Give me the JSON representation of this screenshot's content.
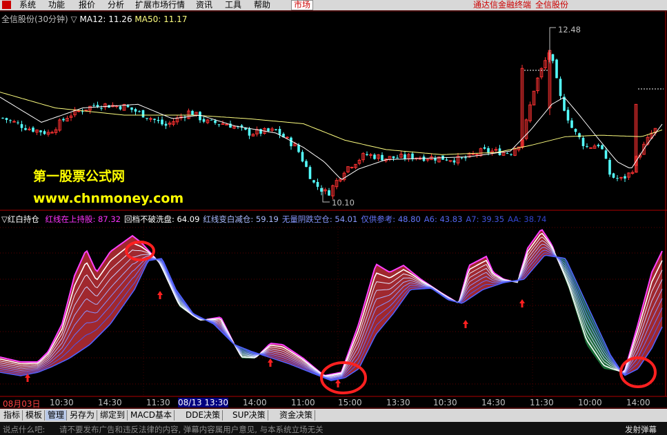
{
  "menu": {
    "items": [
      "系统",
      "功能",
      "报价",
      "分析",
      "扩展市场行情",
      "资讯",
      "工具",
      "帮助"
    ],
    "active": "市场",
    "right_items": [
      "通达信金融终端",
      "全信股份"
    ]
  },
  "main_chart": {
    "title": "全信股份(30分钟)",
    "ma12_label": "MA12: 11.26",
    "ma50_label": "MA50: 11.17",
    "high_label": "12.48",
    "low_label": "10.10"
  },
  "watermark": {
    "line1": "第一股票公式网",
    "line2": "www.chnmoney.com"
  },
  "indicator": {
    "title": "▽红白持仓",
    "items": [
      {
        "label": "红线在上持股:",
        "value": "87.32",
        "color": "#ff33ff"
      },
      {
        "label": "回档不破洗盘:",
        "value": "64.09",
        "color": "#ffffff"
      },
      {
        "label": "红线变白减仓:",
        "value": "59.19",
        "color": "#aabbff"
      },
      {
        "label": "无量阴跌空仓:",
        "value": "54.01",
        "color": "#8899ff"
      },
      {
        "label": "仅供参考:",
        "value": "48.80",
        "color": "#6677ff"
      },
      {
        "label": "A6:",
        "value": "43.83",
        "color": "#5566ee"
      },
      {
        "label": "A7:",
        "value": "39.35",
        "color": "#4455dd"
      },
      {
        "label": "AA:",
        "value": "38.74",
        "color": "#3344cc"
      }
    ]
  },
  "time_axis": [
    "08月03日",
    "10:30",
    "14:30",
    "11:30",
    "08/13 13:30",
    "14:00",
    "11:00",
    "15:00",
    "13:30",
    "10:30",
    "14:30",
    "11:30",
    "10:00",
    "14:00"
  ],
  "tabs": [
    "指标",
    "模板",
    "管理",
    "另存为",
    "绑定到",
    "MACD基本",
    "DDE决策",
    "SUP决策",
    "资金决策"
  ],
  "selected_tab": "管理",
  "status": {
    "left": "说点什么吧:",
    "notice": "请不要发布广告和违反法律的内容, 弹幕内容属用户意见, 与本系统立场无关",
    "right": "发射弹幕"
  },
  "colors": {
    "up": "#ff3232",
    "down": "#54ffff",
    "ma12": "#ffffff",
    "ma50": "#ffff80",
    "red_fill": "#a0282e",
    "green_fill": "#1b6b36",
    "magenta": "#ff40ff",
    "circle": "#ff2020"
  }
}
